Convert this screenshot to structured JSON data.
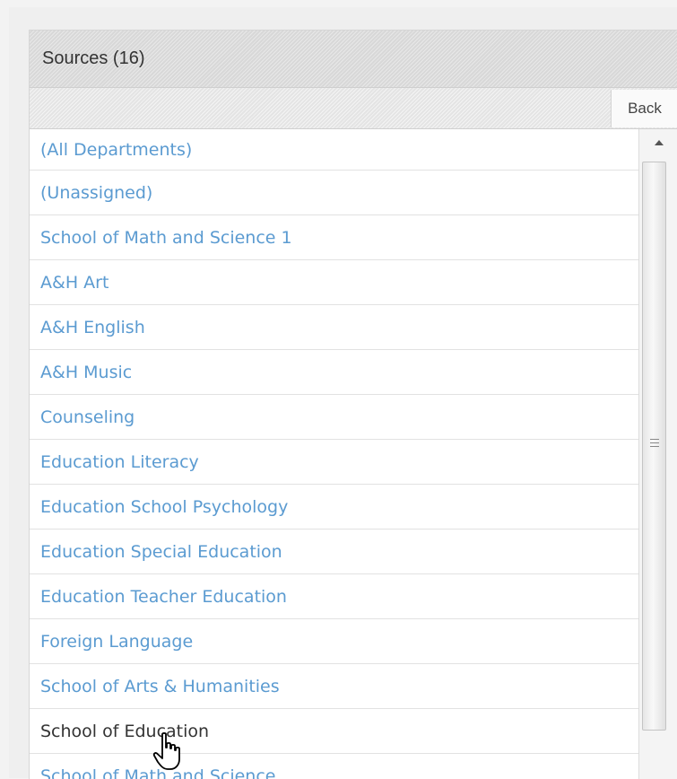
{
  "panel": {
    "title": "Sources (16)",
    "back_label": "Back"
  },
  "list": {
    "items": [
      "(All Departments)",
      "(Unassigned)",
      "School of Math and Science 1",
      "A&H Art",
      "A&H English",
      "A&H Music",
      "Counseling",
      "Education Literacy",
      "Education School Psychology",
      "Education Special Education",
      "Education Teacher Education",
      "Foreign Language",
      "School of Arts & Humanities",
      "School of Education",
      "School of Math and Science"
    ],
    "hovered_index": 13
  },
  "colors": {
    "link": "#5b9bd1",
    "hover_text": "#333333",
    "header_bg": "#dcdcdc"
  },
  "icons": {
    "scroll_up": "triangle-up-icon",
    "scroll_grip": "grip-lines-icon",
    "cursor": "hand-pointer-icon"
  }
}
